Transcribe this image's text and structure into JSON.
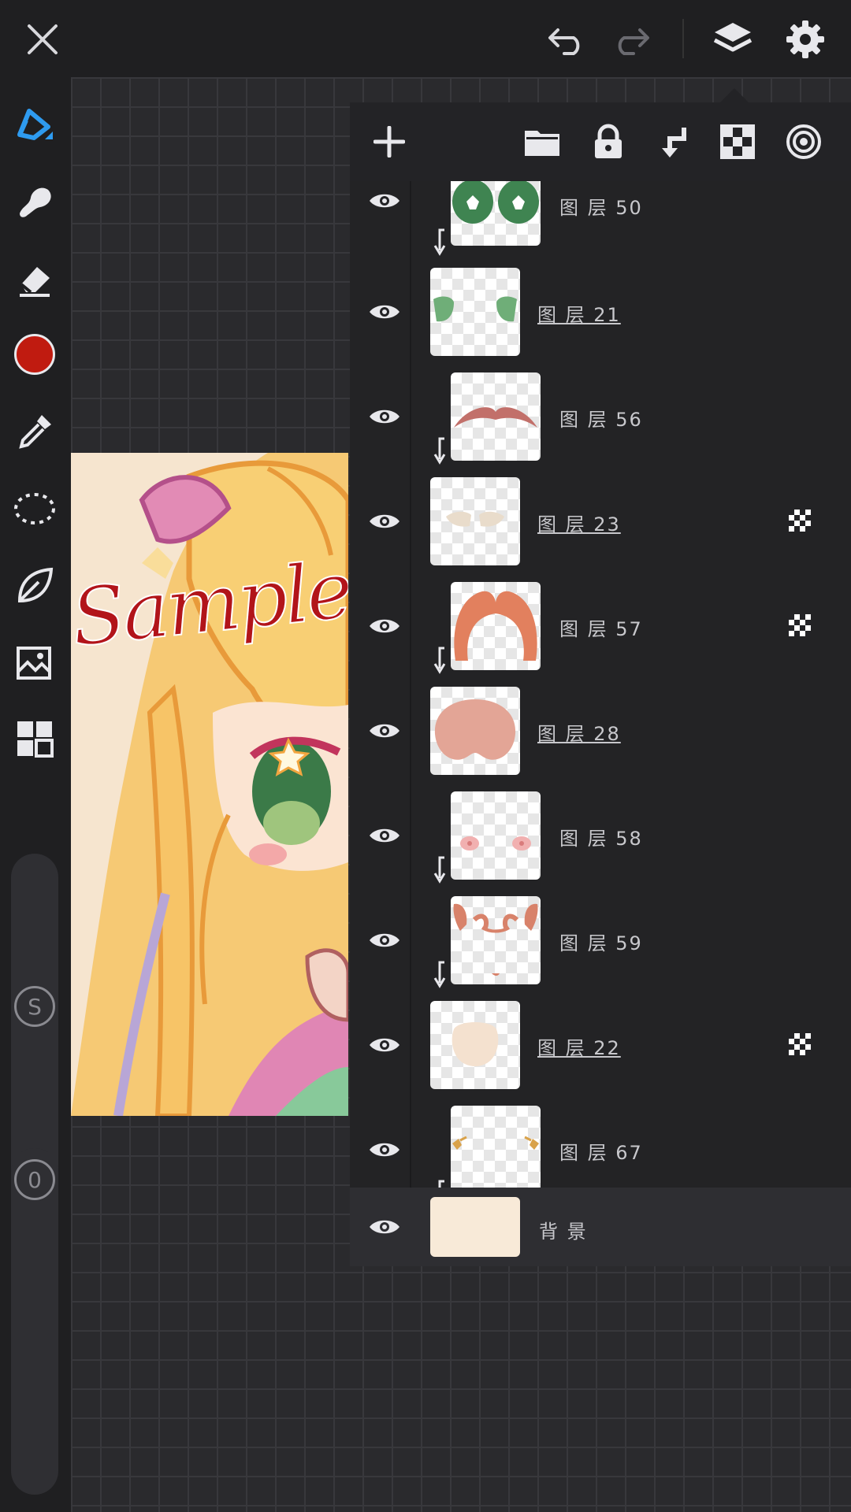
{
  "toolbar_top": {
    "close": "close-icon",
    "undo": "undo-icon",
    "redo": "redo-icon",
    "layers": "layers-icon",
    "settings": "gear-icon"
  },
  "tools": [
    "pen-icon",
    "smudge-icon",
    "eraser-icon",
    "color-swatch",
    "eyedropper-icon",
    "lasso-icon",
    "leaf-icon",
    "image-import-icon",
    "grid-menu-icon"
  ],
  "colors": {
    "primary_color": "#c01b10",
    "accent": "#2e9bf0",
    "background_layer": "#f8ead8"
  },
  "sliders": {
    "size_label": "S",
    "opacity_label": "0"
  },
  "artwork": {
    "watermark": "Sample."
  },
  "layer_panel": {
    "header_icons": [
      "add-layer-icon",
      "folder-icon",
      "lock-icon",
      "clip-mask-icon",
      "alpha-lock-icon",
      "blend-mode-icon"
    ],
    "layers": [
      {
        "name": "图 层 50",
        "clipped": true,
        "underline": false,
        "alpha": false
      },
      {
        "name": "图 层 21",
        "clipped": false,
        "underline": true,
        "alpha": false
      },
      {
        "name": "图 层 56",
        "clipped": true,
        "underline": false,
        "alpha": false
      },
      {
        "name": "图 层 23",
        "clipped": false,
        "underline": true,
        "alpha": true
      },
      {
        "name": "图 层 57",
        "clipped": true,
        "underline": false,
        "alpha": true
      },
      {
        "name": "图 层 28",
        "clipped": false,
        "underline": true,
        "alpha": false
      },
      {
        "name": "图 层 58",
        "clipped": true,
        "underline": false,
        "alpha": false
      },
      {
        "name": "图 层 59",
        "clipped": true,
        "underline": false,
        "alpha": false
      },
      {
        "name": "图 层 22",
        "clipped": false,
        "underline": true,
        "alpha": true
      },
      {
        "name": "图 层 67",
        "clipped": true,
        "underline": false,
        "alpha": false
      }
    ],
    "background_layer_name": "背 景"
  }
}
